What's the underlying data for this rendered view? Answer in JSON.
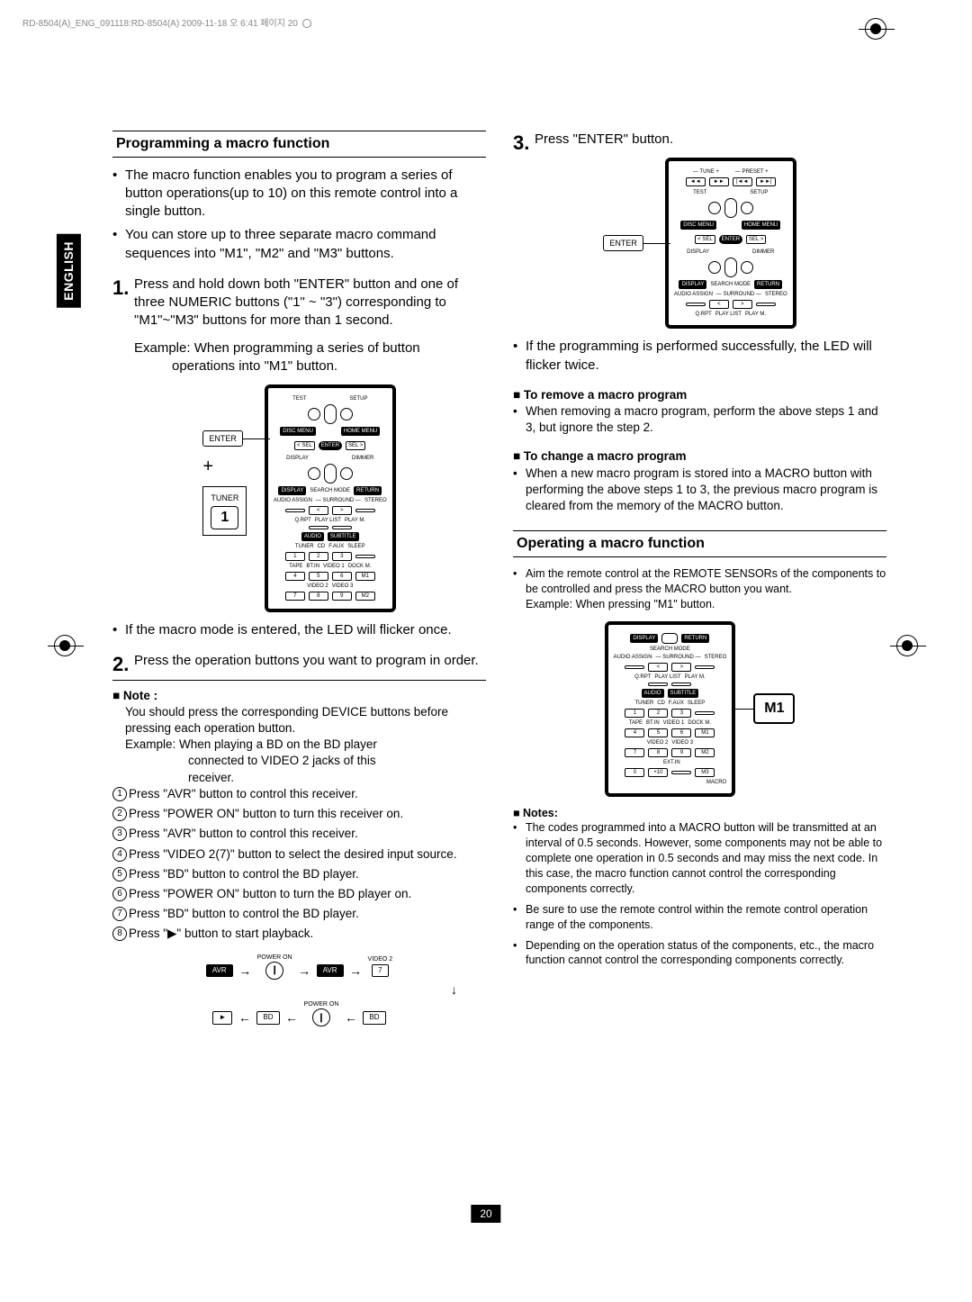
{
  "header": "RD-8504(A)_ENG_091118:RD-8504(A)  2009-11-18  오  6:41  페이지 20",
  "side_tab": "ENGLISH",
  "page_num": "20",
  "col1": {
    "section_head": "Programming a macro function",
    "bullets": [
      "The macro function enables you to program a series of button operations(up to 10) on this remote control into a single button.",
      "You can store up to three separate macro command sequences into \"M1\", \"M2\" and \"M3\" buttons."
    ],
    "step1_num": "1.",
    "step1": "Press and hold down both \"ENTER\" button and one of three NUMERIC buttons (\"1\" ~ \"3\") corresponding to \"M1\"~\"M3\" buttons for more than 1 second.",
    "example1a": "Example: When programming a series of button",
    "example1b": "operations into \"M1\" button.",
    "enter_label": "ENTER",
    "tuner_label": "TUNER",
    "tuner_num": "1",
    "bullet_after": "If  the macro mode is entered, the LED will flicker once.",
    "step2_num": "2.",
    "step2": "Press the operation buttons you want to program in order.",
    "note_head": "■ Note :",
    "note_body1": "You should press the corresponding DEVICE buttons before pressing each operation button.",
    "note_body2a": "Example: When playing a BD on the BD player",
    "note_body2b": "connected to VIDEO 2 jacks of this",
    "note_body2c": "receiver.",
    "circled": [
      "Press \"AVR\" button to control this receiver.",
      "Press \"POWER ON\" button to turn this receiver on.",
      "Press \"AVR\" button to control this receiver.",
      "Press \"VIDEO 2(7)\" button to select the desired input source.",
      "Press \"BD\" button to control the BD player.",
      "Press \"POWER ON\" button to turn the BD player on.",
      "Press \"BD\" button to control the BD player.",
      "Press \"▶\" button to start playback."
    ],
    "flow": {
      "power_on": "POWER ON",
      "avr": "AVR",
      "video2": "VIDEO 2",
      "seven": "7",
      "bd": "BD",
      "play": "►"
    }
  },
  "col2": {
    "step3_num": "3.",
    "step3": "Press \"ENTER\" button.",
    "enter_label": "ENTER",
    "bullet_after3": "If the programming is performed successfully, the LED will flicker twice.",
    "remove_head": "■ To remove a macro program",
    "remove_body": "When removing a macro program, perform the above steps 1 and 3, but ignore the step 2.",
    "change_head": "■ To change a macro program",
    "change_body": "When a new macro program is stored into a MACRO button with performing the above steps 1 to 3, the previous macro program is cleared from the memory of the MACRO button.",
    "section_head2": "Operating a macro function",
    "op_bullet1": "Aim the remote control at the REMOTE SENSORs of the components to be controlled and press the MACRO button you want.",
    "op_example": "Example: When pressing \"M1\" button.",
    "m1_label": "M1",
    "notes_head": "■ Notes:",
    "notes": [
      "The codes programmed into a MACRO button will be transmitted at an interval of 0.5 seconds. However, some components may not be able to complete one operation in 0.5 seconds and may miss the next code. In this case, the macro function cannot control the corresponding components correctly.",
      "Be sure to use the remote control within the remote control operation range of the components.",
      "Depending on the operation status of the components, etc., the macro function cannot control the corresponding components correctly."
    ]
  },
  "remote_labels": {
    "tune": "TUNE",
    "preset": "PRESET",
    "test": "TEST",
    "setup": "SETUP",
    "disc_menu": "DISC MENU",
    "home_menu": "HOME MENU",
    "sel_l": "< SEL",
    "enter": "ENTER",
    "sel_r": "SEL >",
    "display": "DISPLAY",
    "dimmer": "DIMMER",
    "search": "SEARCH MODE",
    "return": "RETURN",
    "audio_assign": "AUDIO ASSIGN",
    "surround": "SURROUND",
    "stereo": "STEREO",
    "qrpt": "Q.RPT",
    "playlist": "PLAY LIST",
    "playm": "PLAY M.",
    "audio": "AUDIO",
    "subtitle": "SUBTITLE",
    "tuner": "TUNER",
    "cd": "CD",
    "faux": "F.AUX",
    "sleep": "SLEEP",
    "tape": "TAPE",
    "btin": "BT.IN",
    "video1": "VIDEO 1",
    "dockm": "DOCK M.",
    "video2": "VIDEO 2",
    "video3": "VIDEO 3",
    "extin": "EXT.IN",
    "macro": "MACRO",
    "m1": "M1",
    "m2": "M2",
    "m3": "M3"
  }
}
